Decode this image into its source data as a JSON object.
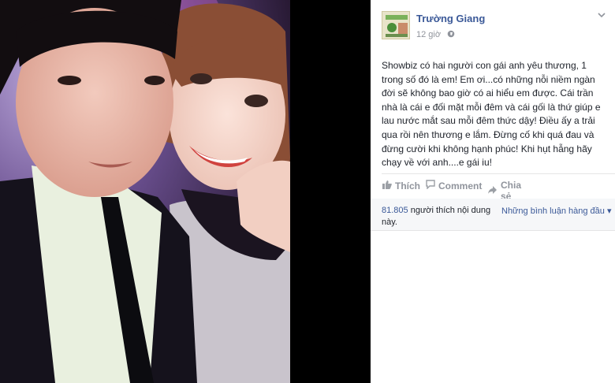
{
  "post": {
    "author": "Trường Giang",
    "time": "12 giờ",
    "privacy_icon": "globe-icon",
    "options_icon": "chevron-down-icon",
    "text_lines": [
      "Showbiz có hai người con gái anh yêu thương, 1",
      "trong số đó là em! Em ơi...có những nỗi niềm ngàn",
      "đời sẽ không bao giờ có ai hiểu em được. Cái trần",
      "nhà là cái e đối mặt mỗi đêm và cái gối là thứ giúp e",
      "lau nước mắt sau mỗi đêm thức dậy! Điều ấy a trải",
      "qua rồi nên thương e lắm. Đừng cố khi quá đau và",
      "đừng cười khi không hạnh phúc! Khi hụt hẫng hãy",
      "chạy về với anh....e gái iu!"
    ]
  },
  "actions": {
    "like": "Thích",
    "comment": "Comment",
    "share": "Chia sẻ"
  },
  "likes": {
    "count": "81.805",
    "text_1": " người thích nội dung",
    "text_2": "này.",
    "sort_label": "Những bình luận hàng đầu",
    "sort_icon": "▾"
  },
  "colors": {
    "link": "#3b5998",
    "muted": "#90949c",
    "text": "#1d2129"
  }
}
